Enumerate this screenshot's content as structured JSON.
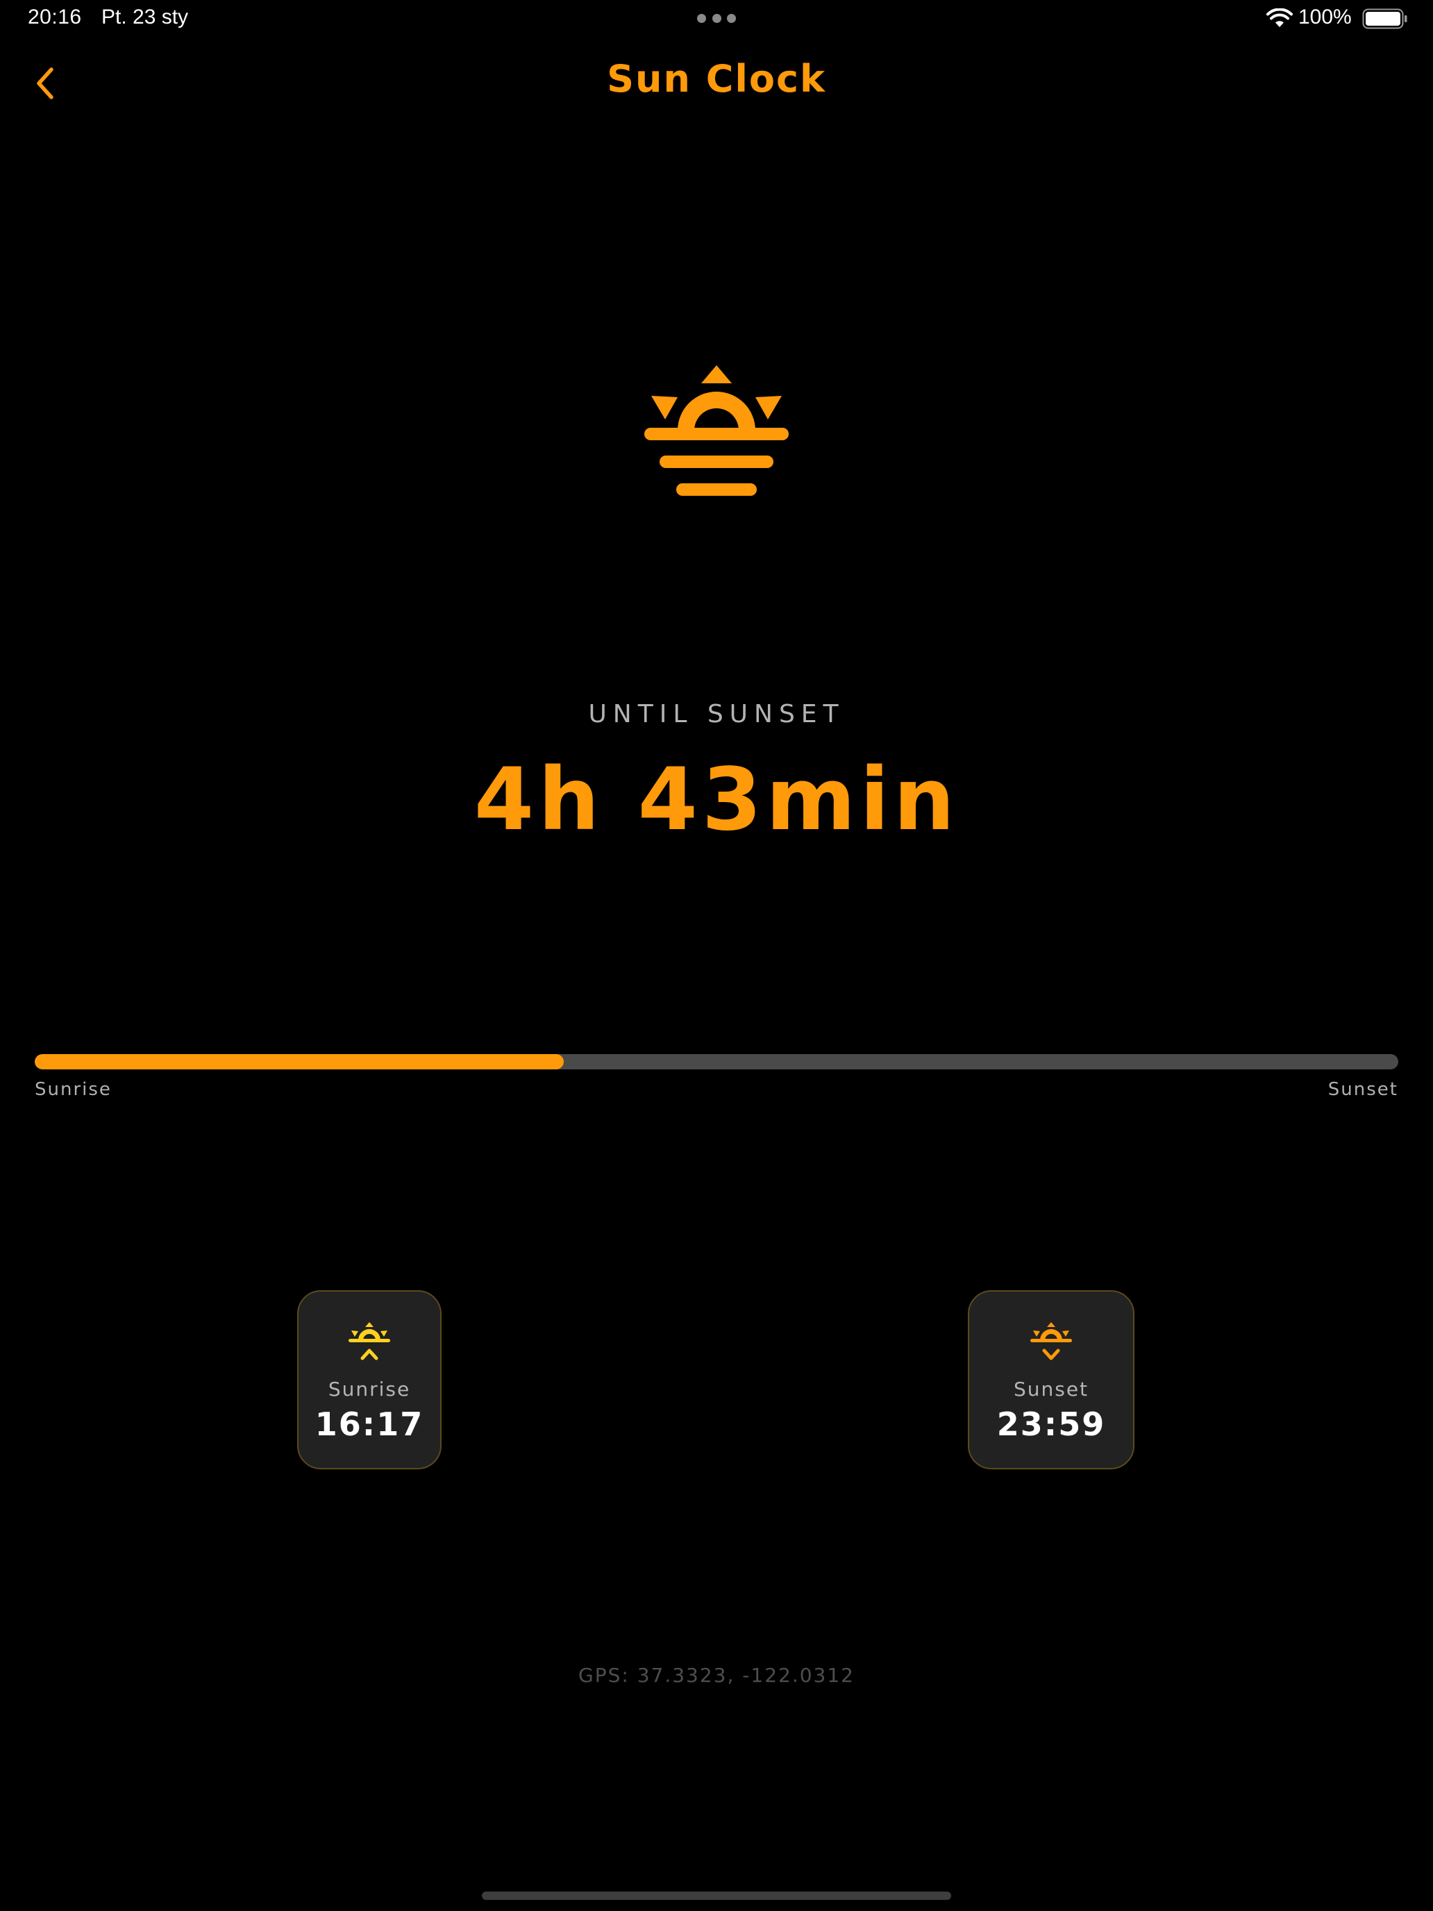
{
  "status_bar": {
    "time": "20:16",
    "date": "Pt. 23 sty",
    "battery_percent": "100%",
    "icons": [
      "multitask-dots-icon",
      "wifi-icon",
      "battery-icon"
    ]
  },
  "nav": {
    "title": "Sun Clock",
    "back_icon": "chevron-left-icon"
  },
  "hero": {
    "icon": "sunset-icon",
    "label": "UNTIL SUNSET",
    "countdown": "4h 43min"
  },
  "progress": {
    "fraction": 0.388,
    "start_label": "Sunrise",
    "end_label": "Sunset"
  },
  "cards": {
    "sunrise": {
      "icon": "sunrise-icon",
      "label": "Sunrise",
      "time": "16:17"
    },
    "sunset": {
      "icon": "sunset-icon",
      "label": "Sunset",
      "time": "23:59"
    }
  },
  "gps": "GPS: 37.3323, -122.0312",
  "colors": {
    "accent": "#ff9a0a",
    "sunrise_accent": "#ffd21f",
    "background": "#000000",
    "card_bg": "#222222",
    "card_border": "#5c4a1c",
    "track": "#4a4a4a"
  }
}
